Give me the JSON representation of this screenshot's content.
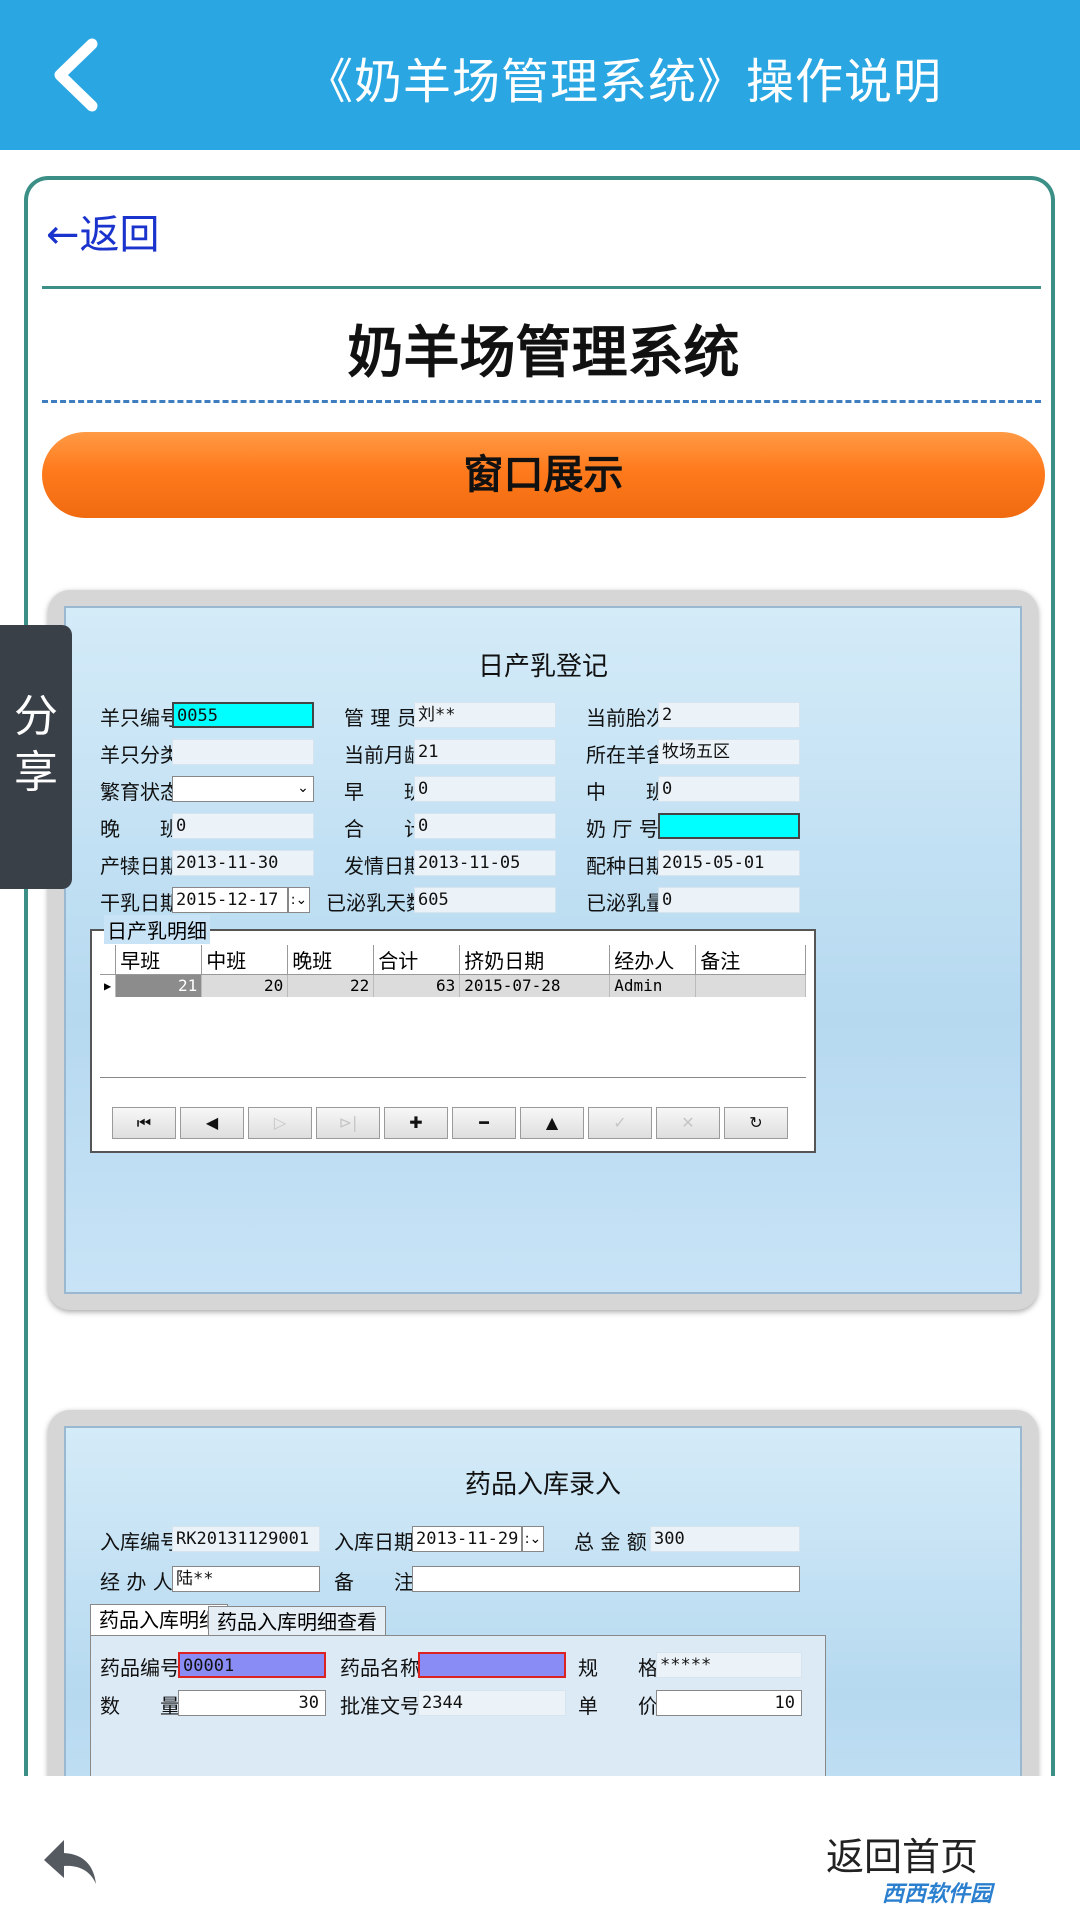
{
  "header": {
    "title": "《奶羊场管理系统》操作说明"
  },
  "card": {
    "back_link": "←返回",
    "doc_title": "奶羊场管理系统",
    "section_title": "窗口展示"
  },
  "share": {
    "label_1": "分",
    "label_2": "享"
  },
  "win1": {
    "title": "日产乳登记",
    "fields": {
      "sheep_no_label": "羊只编号",
      "sheep_no_value": "0055",
      "manager_label": "管 理 员",
      "manager_value": "刘**",
      "parity_label": "当前胎次",
      "parity_value": "2",
      "category_label": "羊只分类",
      "category_value": "",
      "age_label": "当前月龄",
      "age_value": "21",
      "pen_label": "所在羊舍",
      "pen_value": "牧场五区",
      "breed_status_label": "繁育状态",
      "breed_status_value": "",
      "morning_label": "早　　班",
      "morning_value": "0",
      "midday_label": "中　　班",
      "midday_value": "0",
      "evening_label": "晚　　班",
      "evening_value": "0",
      "total_label": "合　　计",
      "total_value": "0",
      "parlor_label": "奶 厅 号",
      "parlor_value": "",
      "kidding_date_label": "产犊日期",
      "kidding_date_value": "2013-11-30",
      "estrus_date_label": "发情日期",
      "estrus_date_value": "2013-11-05",
      "mating_date_label": "配种日期",
      "mating_date_value": "2015-05-01",
      "dry_date_label": "干乳日期",
      "dry_date_value": "2015-12-17",
      "lact_days_label": "已泌乳天数",
      "lact_days_value": "605",
      "lact_amount_label": "已泌乳量",
      "lact_amount_value": "0",
      "dropdown_glyph": "⌄",
      "date_dropdown_glyph": ":⌄"
    },
    "detail": {
      "label": "日产乳明细",
      "columns": [
        "早班",
        "中班",
        "晚班",
        "合计",
        "挤奶日期",
        "经办人",
        "备注"
      ],
      "rows": [
        {
          "indicator": "▶",
          "cells": [
            "21",
            "20",
            "22",
            "63",
            "2015-07-28",
            "Admin",
            ""
          ]
        }
      ]
    },
    "nav": {
      "first": "⏮",
      "prev": "◀",
      "next": "▷",
      "last": "⊳|",
      "add": "✚",
      "delete": "━",
      "up": "▲",
      "post": "✓",
      "cancel": "✕",
      "refresh": "↻"
    }
  },
  "win2": {
    "title": "药品入库录入",
    "fields": {
      "in_no_label": "入库编号",
      "in_no_value": "RK20131129001",
      "in_date_label": "入库日期",
      "in_date_value": "2013-11-29",
      "amount_label": "总 金 额",
      "amount_value": "300",
      "handler_label": "经 办 人",
      "handler_value": "陆**",
      "remark_label": "备　　注",
      "remark_value": "",
      "date_dropdown_glyph": ":⌄"
    },
    "tabs": [
      "药品入库明细",
      "药品入库明细查看"
    ],
    "detail_fields": {
      "drug_no_label": "药品编号",
      "drug_no_value": "00001",
      "drug_name_label": "药品名称",
      "drug_name_value": "",
      "spec_label": "规　　格",
      "spec_value": "*****",
      "qty_label": "数　　量",
      "qty_value": "30",
      "approval_label": "批准文号",
      "approval_value": "2344",
      "price_label": "单　　价",
      "price_value": "10"
    }
  },
  "footer": {
    "home_label": "返回首页",
    "watermark": "西西软件园"
  }
}
